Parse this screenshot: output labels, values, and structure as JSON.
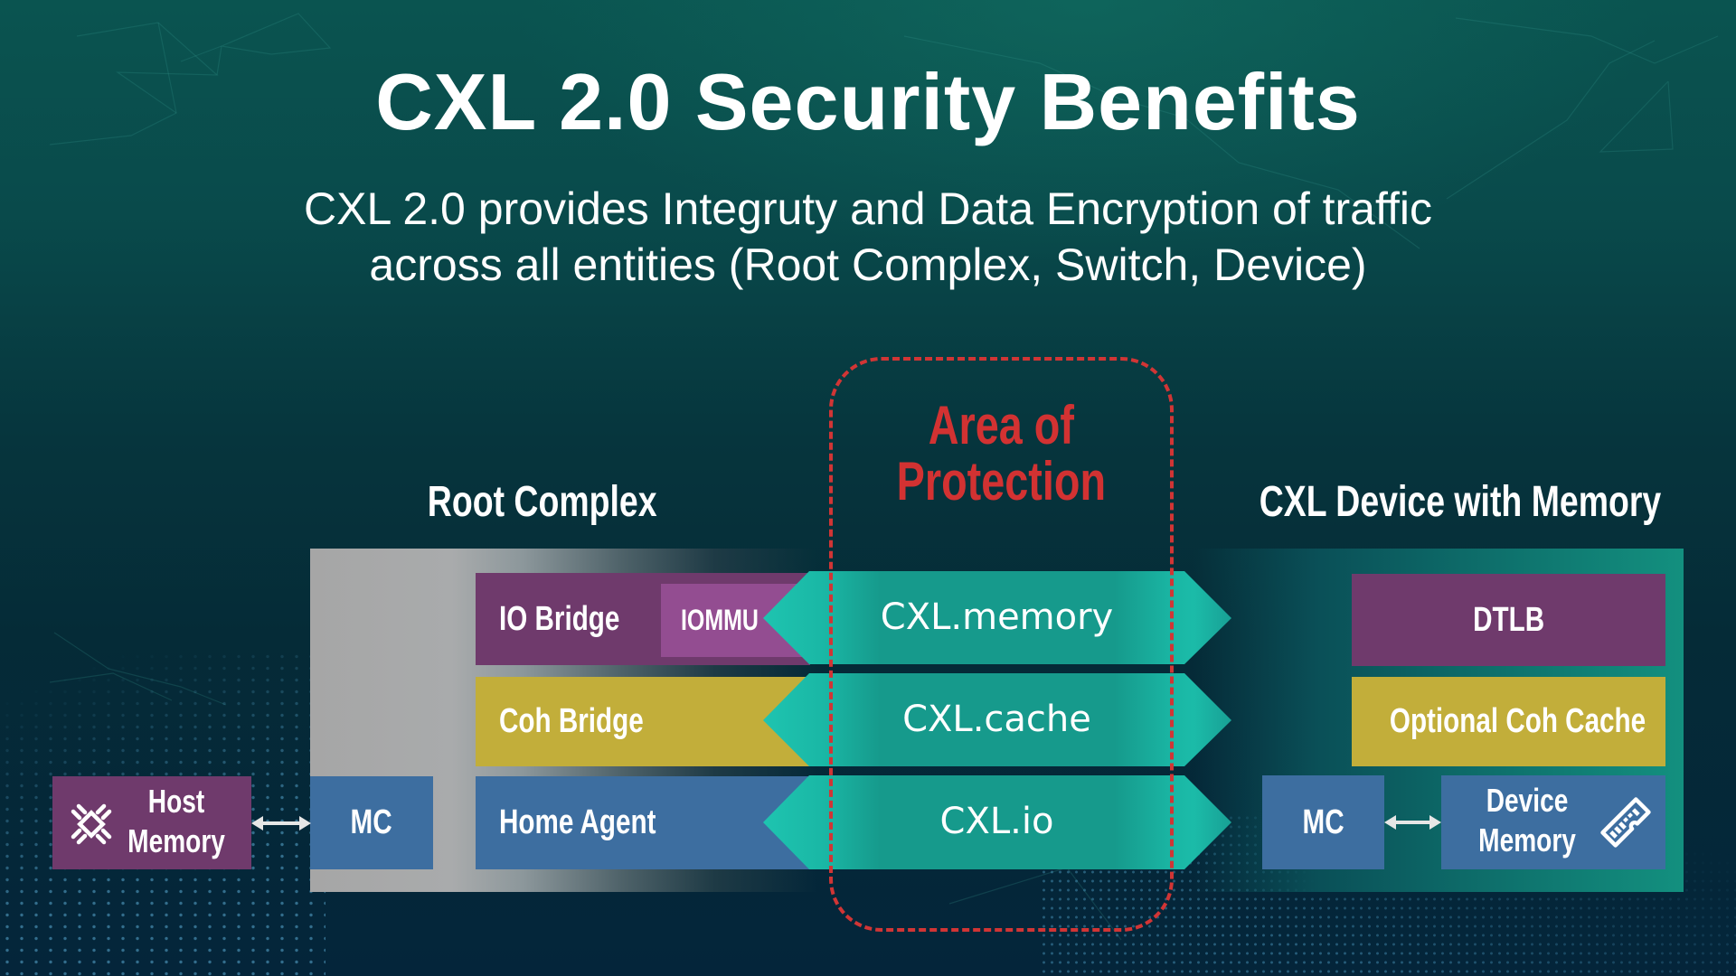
{
  "title": "CXL 2.0 Security Benefits",
  "subtitle": {
    "line1": "CXL 2.0 provides Integruty and Data Encryption of traffic",
    "line2": "across all entities (Root Complex, Switch, Device)"
  },
  "protection_area": {
    "line1": "Area of",
    "line2": "Protection",
    "color": "#d23232"
  },
  "root_complex": {
    "label": "Root Complex",
    "blocks": {
      "io_bridge": "IO Bridge",
      "iommu": "IOMMU",
      "coh_bridge": "Coh Bridge",
      "home_agent": "Home Agent",
      "mc": "MC"
    },
    "host_memory": {
      "line1": "Host",
      "line2": "Memory",
      "icon": "chip-icon"
    }
  },
  "protocols": [
    {
      "label": "CXL.memory"
    },
    {
      "label": "CXL.cache"
    },
    {
      "label": "CXL.io"
    }
  ],
  "device": {
    "label": "CXL Device with Memory",
    "blocks": {
      "dtlb": "DTLB",
      "optional_cache": "Optional Coh Cache",
      "mc": "MC"
    },
    "device_memory": {
      "line1": "Device",
      "line2": "Memory",
      "icon": "memory-module-icon"
    }
  },
  "colors": {
    "purple": "#6f3a6c",
    "purple_light": "#934d91",
    "yellow": "#c2ae3a",
    "blue": "#3d6ea0",
    "teal": "#169a8c",
    "teal_tip": "#1ec4b0"
  }
}
